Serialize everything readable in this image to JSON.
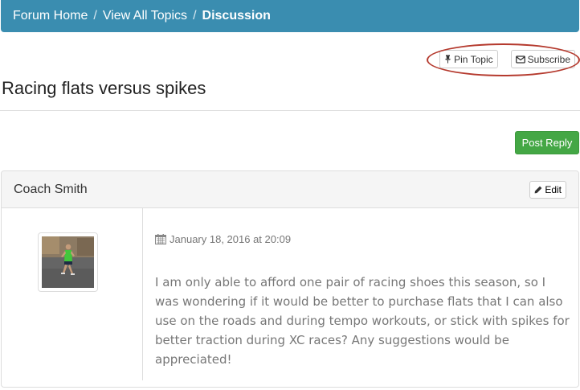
{
  "breadcrumb": {
    "items": [
      "Forum Home",
      "View All Topics"
    ],
    "separator": "/",
    "current": "Discussion"
  },
  "topic": {
    "title": "Racing flats versus spikes",
    "pin_label": "Pin Topic",
    "subscribe_label": "Subscribe"
  },
  "actions": {
    "post_reply_label": "Post Reply"
  },
  "post": {
    "author": "Coach Smith",
    "edit_label": "Edit",
    "date": "January 18, 2016 at 20:09",
    "body": "I am only able to afford one pair of racing shoes this season, so I was wondering if it would be better to purchase flats that I can also use on the roads and during tempo workouts, or stick with spikes for better traction during XC races? Any suggestions would be appreciated!"
  },
  "colors": {
    "header_bg": "#3a8db0",
    "post_reply_bg": "#44a745",
    "annotation_ring": "#b53a2e"
  },
  "icons": {
    "pin": "pushpin-icon",
    "subscribe": "envelope-icon",
    "edit": "pencil-icon",
    "date": "calendar-icon"
  }
}
